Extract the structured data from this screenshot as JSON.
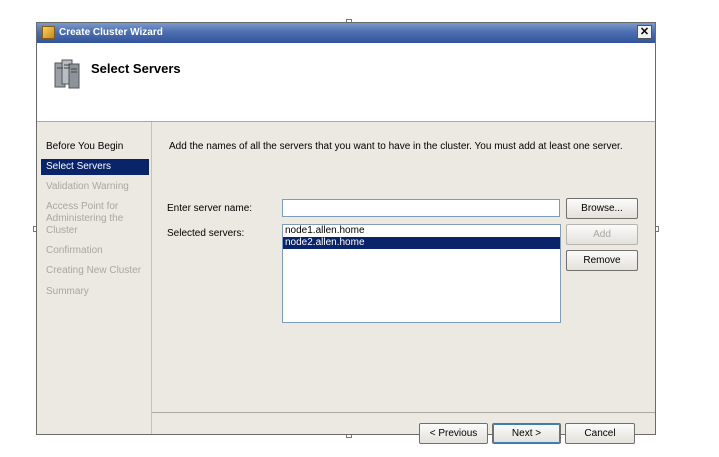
{
  "window": {
    "title": "Create Cluster Wizard",
    "close_glyph": "✕"
  },
  "header": {
    "title": "Select Servers"
  },
  "nav": {
    "items": [
      {
        "label": "Before You Begin"
      },
      {
        "label": "Select Servers"
      },
      {
        "label": "Validation Warning"
      },
      {
        "label": "Access Point for Administering the Cluster"
      },
      {
        "label": "Confirmation"
      },
      {
        "label": "Creating New Cluster"
      },
      {
        "label": "Summary"
      }
    ]
  },
  "content": {
    "instruction": "Add the names of all the servers that you want to have in the cluster. You must add at least one server.",
    "server_name_label": "Enter server name:",
    "server_name_value": "",
    "selected_servers_label": "Selected servers:",
    "selected_servers": [
      "node1.allen.home",
      "node2.allen.home"
    ],
    "browse_label": "Browse...",
    "add_label": "Add",
    "remove_label": "Remove"
  },
  "footer": {
    "previous_label": "< Previous",
    "next_label": "Next >",
    "cancel_label": "Cancel"
  },
  "icons": {
    "app": "cluster-wizard-icon",
    "header": "servers-icon"
  },
  "colors": {
    "titlebar": "#34539a",
    "selection": "#0a246a",
    "dialog_bg": "#ece9e2"
  }
}
